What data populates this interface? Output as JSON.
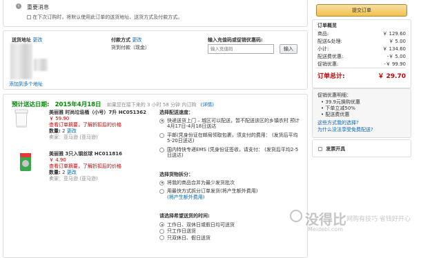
{
  "notice": {
    "title": "重要消息",
    "checkbox_text": "在下次订购时，将默认使用此订单的送货地址、送货方式及付款方式。"
  },
  "address": {
    "label": "送货地址",
    "change": "更改",
    "add_link": "添加到多个地址"
  },
  "payment": {
    "label": "付款方式",
    "change": "更改",
    "value": "货到付款（现金）"
  },
  "coupon": {
    "label": "输入充值码或促销优惠码:",
    "placeholder": "输入充值码",
    "button": "输入"
  },
  "delivery": {
    "label": "预计送达日期:",
    "date": "2015年4月18日",
    "note": "如果您在接下来的 3 小时 58 分钟 内订购",
    "detail": "(详情)"
  },
  "items": [
    {
      "name": "美丽雅 时尚垃圾桶（小号）7升 HC051362",
      "price": "￥ 59.90",
      "promo": "查看订单摘要，了解折扣后的价格",
      "qty_label": "数量:",
      "qty": "2",
      "qty_change": "更改",
      "seller": "卖家：亚马逊",
      "seller_note": "(亚马逊)"
    },
    {
      "name": "美丽雅 3只入钢丝球 HC011816",
      "price": "￥ 4.90",
      "promo": "查看订单摘要，了解折扣后的价格",
      "qty_label": "数量:",
      "qty": "2",
      "qty_change": "更改",
      "seller": "卖家：亚马逊",
      "seller_note": "(亚马逊)"
    }
  ],
  "shipping": {
    "title": "选择配送速度：",
    "options": [
      "快递送货上门 – 城区可以配送，暂不配送该区的乡镇农村 预计4月17日-4月18日送达",
      "平邮(凭身份证在邮局领取包裹，须支付的费用：  (发货后平均5-20日送达)",
      "国内特快专递EMS (凭身份证签收，请支付：  (发货后平均2-5日送达)"
    ]
  },
  "split": {
    "title": "选择货物拆分：",
    "options": [
      "将我的商品合并为最少发货批次",
      "用最快方式拆分订单发货(将产生额外费用)"
    ],
    "link": "(将产生额外费用)"
  },
  "time": {
    "title": "请选择希望送货的时间:",
    "options": [
      "工作日、双休日或假日均可送货",
      "只工作日送货",
      "只双休日、假日送货"
    ]
  },
  "summary": {
    "submit": "提交订单",
    "title": "订单概览",
    "rows": [
      {
        "label": "商品:",
        "value": "￥ 129.60"
      },
      {
        "label": "配送&处理:",
        "value": "￥ 5.00"
      },
      {
        "label": "小计:",
        "value": "￥ 134.60"
      },
      {
        "label": "配送费优惠:",
        "value": "-￥ 5.00"
      },
      {
        "label": "促销优惠:",
        "value": "-￥ 99.90"
      }
    ],
    "total_label": "订单总计:",
    "total_value": "￥ 29.70",
    "promo_title": "促销优惠明细：",
    "promo_items": [
      "39.9元换购优惠",
      "下单立减50%",
      "配送费优惠"
    ],
    "link1": "这些方式我的选择?",
    "link2": "为什么没法享受免费配送?",
    "gift_label": "发票开具"
  },
  "watermark": {
    "main": "没得比",
    "sub": "Meidebi.com",
    "slogan": "网购有技巧 省钱好开心"
  }
}
